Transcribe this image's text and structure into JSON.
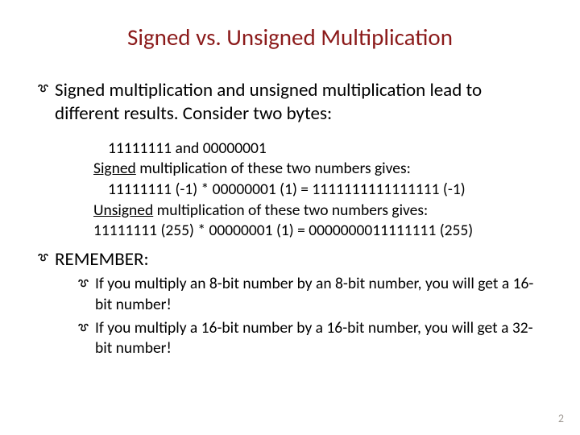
{
  "title": "Signed vs. Unsigned Multiplication",
  "main_bullet": "Signed multiplication and unsigned multiplication lead to different results.  Consider two bytes:",
  "example": {
    "line1": "11111111 and 00000001",
    "signed_label": "Signed",
    "signed_rest": " multiplication of these two numbers gives:",
    "signed_calc": "11111111 (-1) * 00000001 (1) = 1111111111111111  (-1)",
    "unsigned_label": "Unsigned",
    "unsigned_rest": " multiplication of these two numbers gives:",
    "unsigned_calc": "11111111 (255) * 00000001 (1) = 0000000011111111 (255)"
  },
  "remember_label": "REMEMBER:",
  "remember_items": [
    "If you multiply an 8-bit number by an 8-bit number, you will get a 16-bit number!",
    "If you multiply a 16-bit number by a 16-bit number, you will get a 32-bit number!"
  ],
  "page_number": "2"
}
